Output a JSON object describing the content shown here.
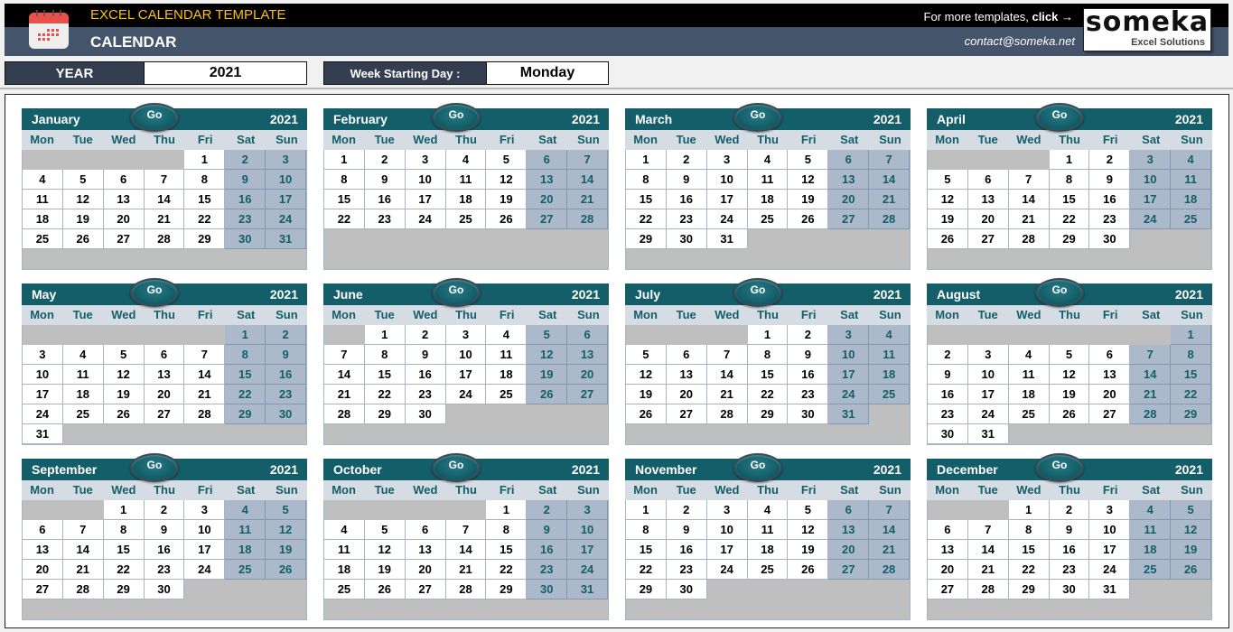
{
  "header": {
    "title_top": "EXCEL CALENDAR TEMPLATE",
    "title_main": "CALENDAR",
    "more_templates_text": "For more templates, ",
    "more_templates_link": "click →",
    "contact": "contact@someka.net",
    "logo_brand": "someka",
    "logo_tagline": "Excel Solutions",
    "icon": "calendar-icon"
  },
  "controls": {
    "year_label": "YEAR",
    "year_value": "2021",
    "week_start_label": "Week Starting Day :",
    "week_start_value": "Monday"
  },
  "colors": {
    "header_teal": "#135e69",
    "weekend_fill": "#acb9ca",
    "title_gold": "#ffc000",
    "subbar": "#44546a"
  },
  "calendar": {
    "year": "2021",
    "go_label": "Go",
    "weekdays": [
      "Mon",
      "Tue",
      "Wed",
      "Thu",
      "Fri",
      "Sat",
      "Sun"
    ],
    "months": [
      {
        "name": "January",
        "offset": 4,
        "days": 31
      },
      {
        "name": "February",
        "offset": 0,
        "days": 28
      },
      {
        "name": "March",
        "offset": 0,
        "days": 31
      },
      {
        "name": "April",
        "offset": 3,
        "days": 30
      },
      {
        "name": "May",
        "offset": 5,
        "days": 31
      },
      {
        "name": "June",
        "offset": 1,
        "days": 30
      },
      {
        "name": "July",
        "offset": 3,
        "days": 31
      },
      {
        "name": "August",
        "offset": 6,
        "days": 31
      },
      {
        "name": "September",
        "offset": 2,
        "days": 30
      },
      {
        "name": "October",
        "offset": 4,
        "days": 31
      },
      {
        "name": "November",
        "offset": 0,
        "days": 30
      },
      {
        "name": "December",
        "offset": 2,
        "days": 31
      }
    ]
  }
}
